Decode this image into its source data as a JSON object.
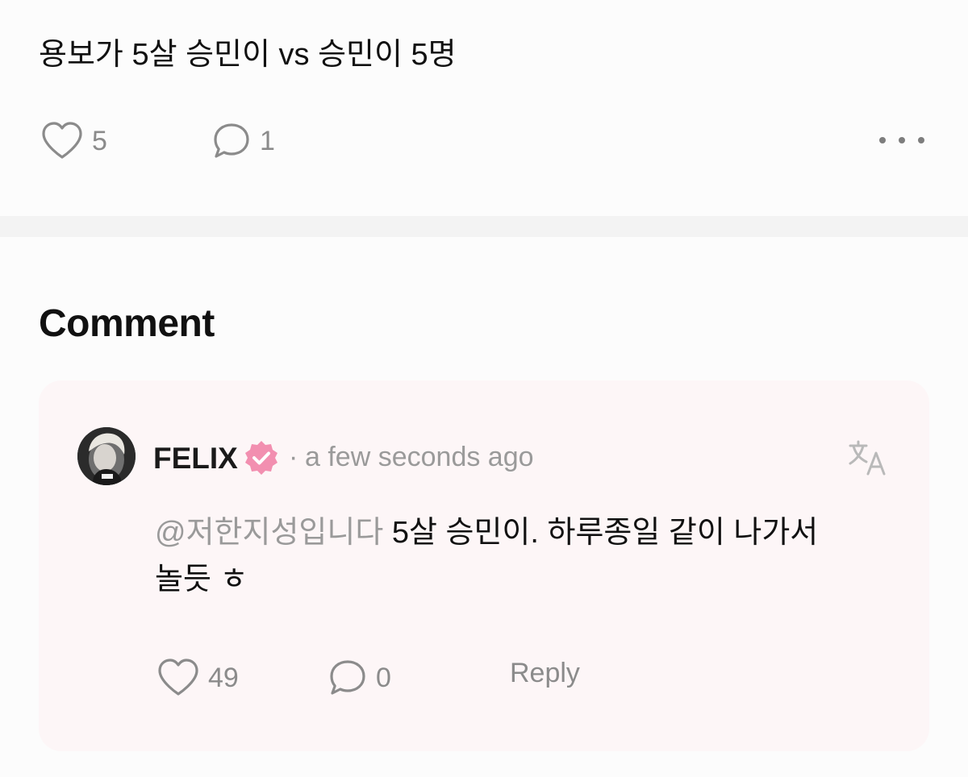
{
  "post": {
    "text": "용보가 5살 승민이 vs 승민이 5명",
    "like_count": "5",
    "comment_count": "1"
  },
  "comments_section": {
    "title": "Comment"
  },
  "comment": {
    "author": "FELIX",
    "separator": "·",
    "timestamp": "a few seconds ago",
    "mention": "@저한지성입니다",
    "body_line1": " 5살 승민이. 하루종일 같이 나가서",
    "body_line2": "놀듯 ㅎ",
    "like_count": "49",
    "reply_count": "0",
    "reply_label": "Reply"
  },
  "colors": {
    "verified_badge": "#f28fb0",
    "card_background": "#fdf6f7",
    "muted_text": "#9a9a9a"
  },
  "icons": [
    "heart-icon",
    "comment-bubble-icon",
    "more-icon",
    "verified-badge-icon",
    "translate-icon"
  ]
}
